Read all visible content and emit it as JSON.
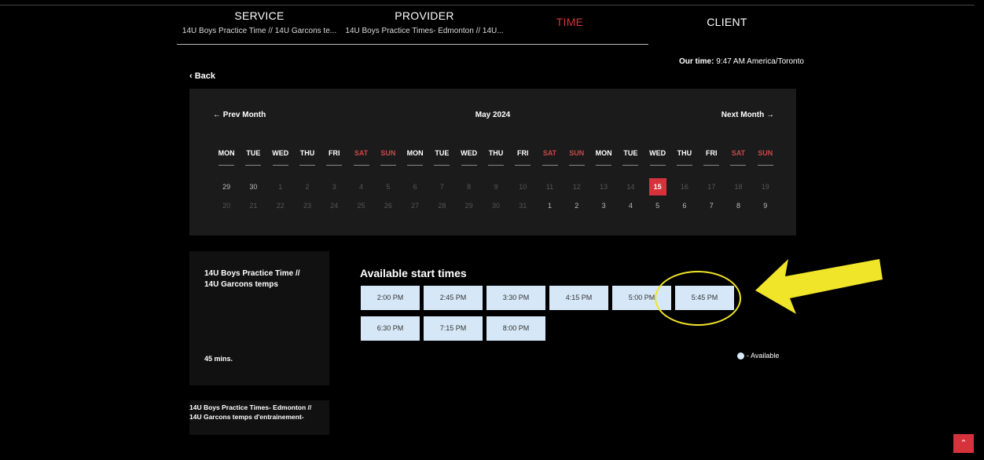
{
  "steps": {
    "service": {
      "title": "SERVICE",
      "sub": "14U Boys Practice Time // 14U Garcons te..."
    },
    "provider": {
      "title": "PROVIDER",
      "sub": "14U Boys Practice Times- Edmonton // 14U..."
    },
    "time": {
      "title": "TIME"
    },
    "client": {
      "title": "CLIENT"
    }
  },
  "our_time": {
    "label": "Our time:",
    "value": "9:47 AM America/Toronto"
  },
  "back": {
    "icon": "chevron-left-icon",
    "label": "Back"
  },
  "calendar": {
    "prev_label": "← Prev Month",
    "month_label": "May 2024",
    "next_label": "Next Month →",
    "dow": [
      "MON",
      "TUE",
      "WED",
      "THU",
      "FRI",
      "SAT",
      "SUN",
      "MON",
      "TUE",
      "WED",
      "THU",
      "FRI",
      "SAT",
      "SUN",
      "MON",
      "TUE",
      "WED",
      "THU",
      "FRI",
      "SAT",
      "SUN"
    ],
    "row1": [
      "29",
      "30",
      "1",
      "2",
      "3",
      "4",
      "5",
      "6",
      "7",
      "8",
      "9",
      "10",
      "11",
      "12",
      "13",
      "14",
      "15",
      "16",
      "17",
      "18",
      "19"
    ],
    "row2": [
      "20",
      "21",
      "22",
      "23",
      "24",
      "25",
      "26",
      "27",
      "28",
      "29",
      "30",
      "31",
      "1",
      "2",
      "3",
      "4",
      "5",
      "6",
      "7",
      "8",
      "9"
    ],
    "selected_day": "15"
  },
  "service_card": {
    "title_line1": "14U Boys Practice Time //",
    "title_line2": "14U Garcons temps",
    "duration": "45 mins."
  },
  "provider_card": {
    "line1": "14U Boys Practice Times- Edmonton //",
    "line2": "14U Garcons temps d'entrainement-"
  },
  "times": {
    "title": "Available start times",
    "slots": [
      "2:00 PM",
      "2:45 PM",
      "3:30 PM",
      "4:15 PM",
      "5:00 PM",
      "5:45 PM",
      "6:30 PM",
      "7:15 PM",
      "8:00 PM"
    ]
  },
  "legend": {
    "label": "- Available"
  },
  "colors": {
    "accent": "#d5323c",
    "slot_bg": "#d6e8f8",
    "highlight": "#f1e52a"
  }
}
